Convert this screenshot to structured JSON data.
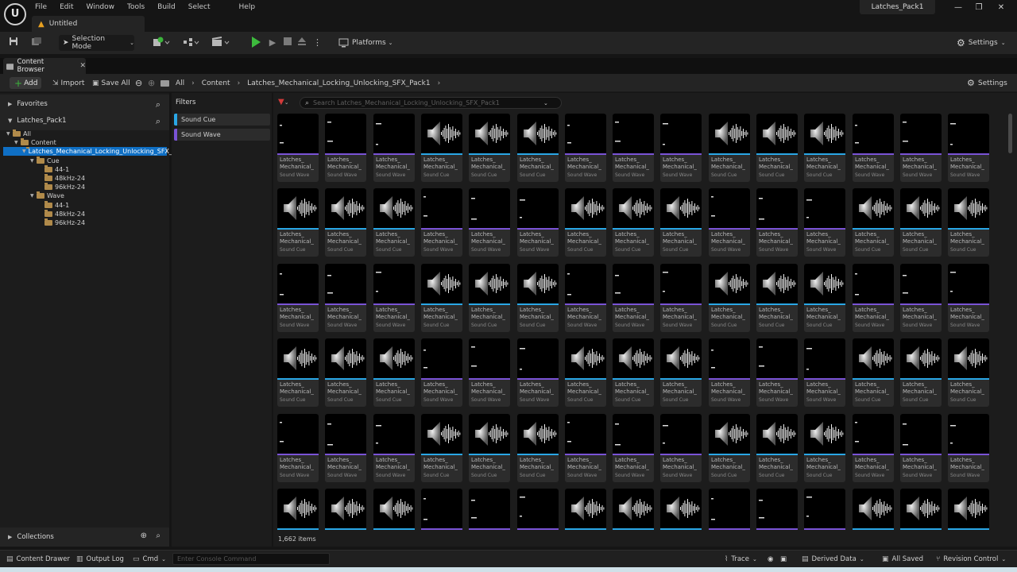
{
  "window": {
    "document_tab": "Untitled",
    "project_name": "Latches_Pack1",
    "menu": [
      "File",
      "Edit",
      "Window",
      "Tools",
      "Build",
      "Select",
      "Help"
    ],
    "controls": {
      "minimize": "—",
      "restore": "❐",
      "close": "✕"
    }
  },
  "toolbar": {
    "mode_label": "Selection Mode",
    "platforms_label": "Platforms",
    "settings_label": "Settings"
  },
  "content_browser": {
    "tab_label": "Content Browser",
    "add_label": "Add",
    "import_label": "Import",
    "save_all_label": "Save All",
    "breadcrumb": [
      "All",
      "Content",
      "Latches_Mechanical_Locking_Unlocking_SFX_Pack1"
    ],
    "settings_label": "Settings",
    "search_placeholder": "Search Latches_Mechanical_Locking_Unlocking_SFX_Pack1",
    "item_count": "1,662 items"
  },
  "tree_panel": {
    "favorites_label": "Favorites",
    "project_label": "Latches_Pack1",
    "collections_label": "Collections",
    "items": [
      {
        "label": "All",
        "depth": 0,
        "expanded": true,
        "selected": false
      },
      {
        "label": "Content",
        "depth": 1,
        "expanded": true,
        "selected": false
      },
      {
        "label": "Latches_Mechanical_Locking_Unlocking_SFX_Pack1",
        "depth": 2,
        "expanded": true,
        "selected": true
      },
      {
        "label": "Cue",
        "depth": 3,
        "expanded": true,
        "selected": false
      },
      {
        "label": "44-1",
        "depth": 4,
        "expanded": false,
        "selected": false
      },
      {
        "label": "48kHz-24",
        "depth": 4,
        "expanded": false,
        "selected": false
      },
      {
        "label": "96kHz-24",
        "depth": 4,
        "expanded": false,
        "selected": false
      },
      {
        "label": "Wave",
        "depth": 3,
        "expanded": true,
        "selected": false
      },
      {
        "label": "44-1",
        "depth": 4,
        "expanded": false,
        "selected": false
      },
      {
        "label": "48kHz-24",
        "depth": 4,
        "expanded": false,
        "selected": false
      },
      {
        "label": "96kHz-24",
        "depth": 4,
        "expanded": false,
        "selected": false
      }
    ]
  },
  "filters_panel": {
    "title": "Filters",
    "items": [
      {
        "label": "Sound Cue",
        "color": "#2aa7e6"
      },
      {
        "label": "Sound Wave",
        "color": "#7a53d6"
      }
    ]
  },
  "assets": {
    "name_line1": "Latches_",
    "name_line2": "Mechanical_",
    "type_labels": {
      "C": "Sound Cue",
      "W": "Sound Wave"
    },
    "strip_colors": {
      "C": "#2aa7e6",
      "W": "#7a53d6"
    },
    "rows": [
      "WWWCCCWWWCCCWWW",
      "CCCWWWCCCWWWCCC",
      "WWWCCCWWWCCCWWW",
      "CCCWWWCCCWWWCCC",
      "WWWCCCWWWCCCWWW",
      "CCCWWWCCCWWWCCC"
    ]
  },
  "statusbar": {
    "content_drawer": "Content Drawer",
    "output_log": "Output Log",
    "cmd_label": "Cmd",
    "console_placeholder": "Enter Console Command",
    "trace_label": "Trace",
    "derived_data_label": "Derived Data",
    "all_saved_label": "All Saved",
    "revision_control_label": "Revision Control"
  }
}
